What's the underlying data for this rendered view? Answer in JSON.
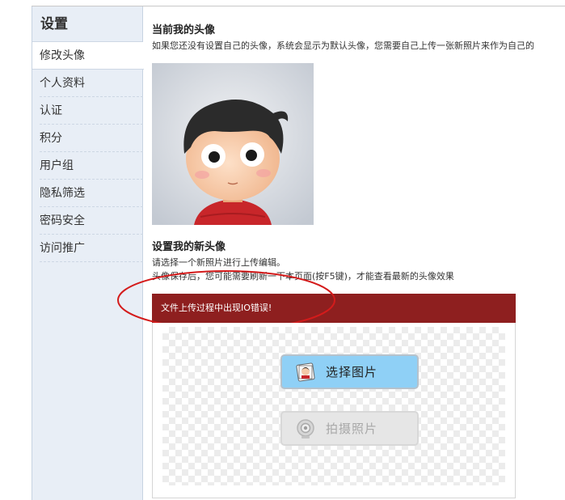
{
  "sidebar": {
    "title": "设置",
    "items": [
      {
        "label": "修改头像",
        "active": true
      },
      {
        "label": "个人资料"
      },
      {
        "label": "认证"
      },
      {
        "label": "积分"
      },
      {
        "label": "用户组"
      },
      {
        "label": "隐私筛选"
      },
      {
        "label": "密码安全"
      },
      {
        "label": "访问推广"
      }
    ]
  },
  "current_avatar": {
    "title": "当前我的头像",
    "description": "如果您还没有设置自己的头像，系统会显示为默认头像，您需要自己上传一张新照片来作为自己的"
  },
  "new_avatar": {
    "title": "设置我的新头像",
    "line1": "请选择一个新照片进行上传编辑。",
    "line2": "头像保存后，您可能需要刷新一下本页面(按F5键)，才能查看最新的头像效果"
  },
  "upload": {
    "error_message": "文件上传过程中出现IO错误!",
    "select_photo_label": "选择图片",
    "take_photo_label": "拍摄照片"
  },
  "colors": {
    "error_bar": "#8e1f1f",
    "select_button": "#8fd0f6",
    "annotation_ellipse": "#d41b1b"
  }
}
